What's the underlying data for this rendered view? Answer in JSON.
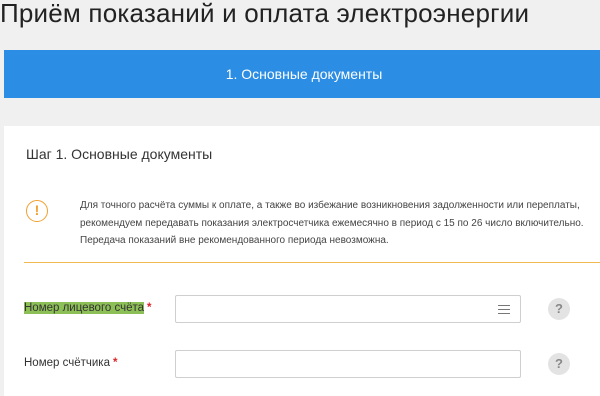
{
  "page": {
    "title": "Приём показаний и оплата электроэнергии"
  },
  "stepper": {
    "active_tab_label": "1. Основные документы"
  },
  "form": {
    "step_heading": "Шаг 1. Основные документы",
    "notice": {
      "icon": "exclamation-icon",
      "lines": [
        "Для точного расчёта суммы к оплате, а также во избежание возникновения задолженности или переплаты,",
        "рекомендуем передавать показания электросчетчика ежемесячно в период с 15 по 26 число включительно.",
        "Передача показаний вне рекомендованного периода невозможна."
      ],
      "icon_color": "#f0a030"
    },
    "fields": [
      {
        "label": "Номер лицевого счёта",
        "required_mark": "*",
        "value": "",
        "has_menu_icon": true,
        "help_glyph": "?"
      },
      {
        "label": "Номер счётчика",
        "required_mark": "*",
        "value": "",
        "has_menu_icon": false,
        "help_glyph": "?"
      }
    ]
  },
  "colors": {
    "accent": "#2b8de3",
    "warning": "#f0a030",
    "required": "#d9262c",
    "highlight": "#8dbf57"
  }
}
